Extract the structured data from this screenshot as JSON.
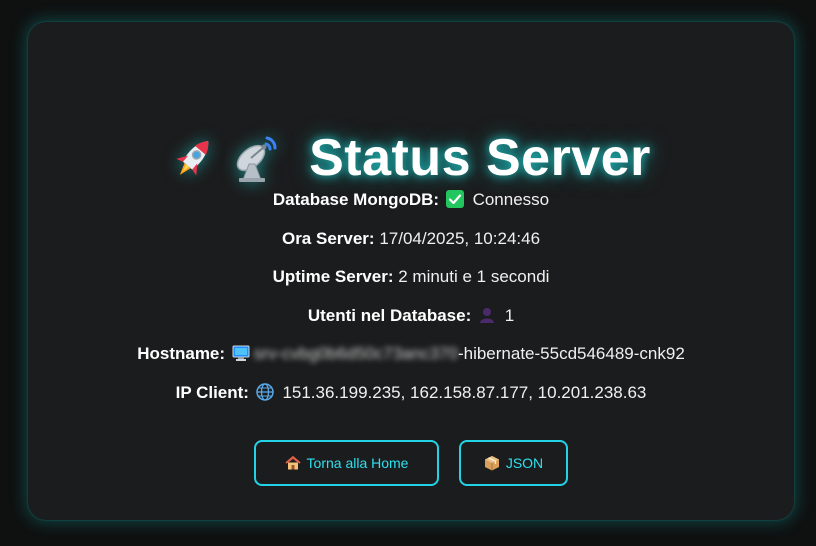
{
  "page": {
    "title": "Status Server",
    "title_icons": [
      "rocket-icon",
      "satellite-dish-icon"
    ]
  },
  "status": {
    "database": {
      "label": "Database MongoDB:",
      "value": "Connesso",
      "icon": "check-mark-icon"
    },
    "server_time": {
      "label": "Ora Server:",
      "value": "17/04/2025, 10:24:46"
    },
    "uptime": {
      "label": "Uptime Server:",
      "value": "2 minuti e 1 secondi"
    },
    "users": {
      "label": "Utenti nel Database:",
      "value": "1",
      "icon": "user-silhouette-icon"
    },
    "hostname": {
      "label": "Hostname:",
      "value_blurred": "srv-cvbg0b6d50c73anc370",
      "value": "-hibernate-55cd546489-cnk92",
      "icon": "computer-icon"
    },
    "ip_client": {
      "label": "IP Client:",
      "value": "151.36.199.235, 162.158.87.177, 10.201.238.63",
      "icon": "globe-icon"
    }
  },
  "actions": {
    "home_label": "Torna alla Home",
    "home_icon": "house-icon",
    "json_label": "JSON",
    "json_icon": "package-icon"
  },
  "colors": {
    "accent": "#22d3e6",
    "success": "#22c55e",
    "background": "#1b1c1d"
  }
}
